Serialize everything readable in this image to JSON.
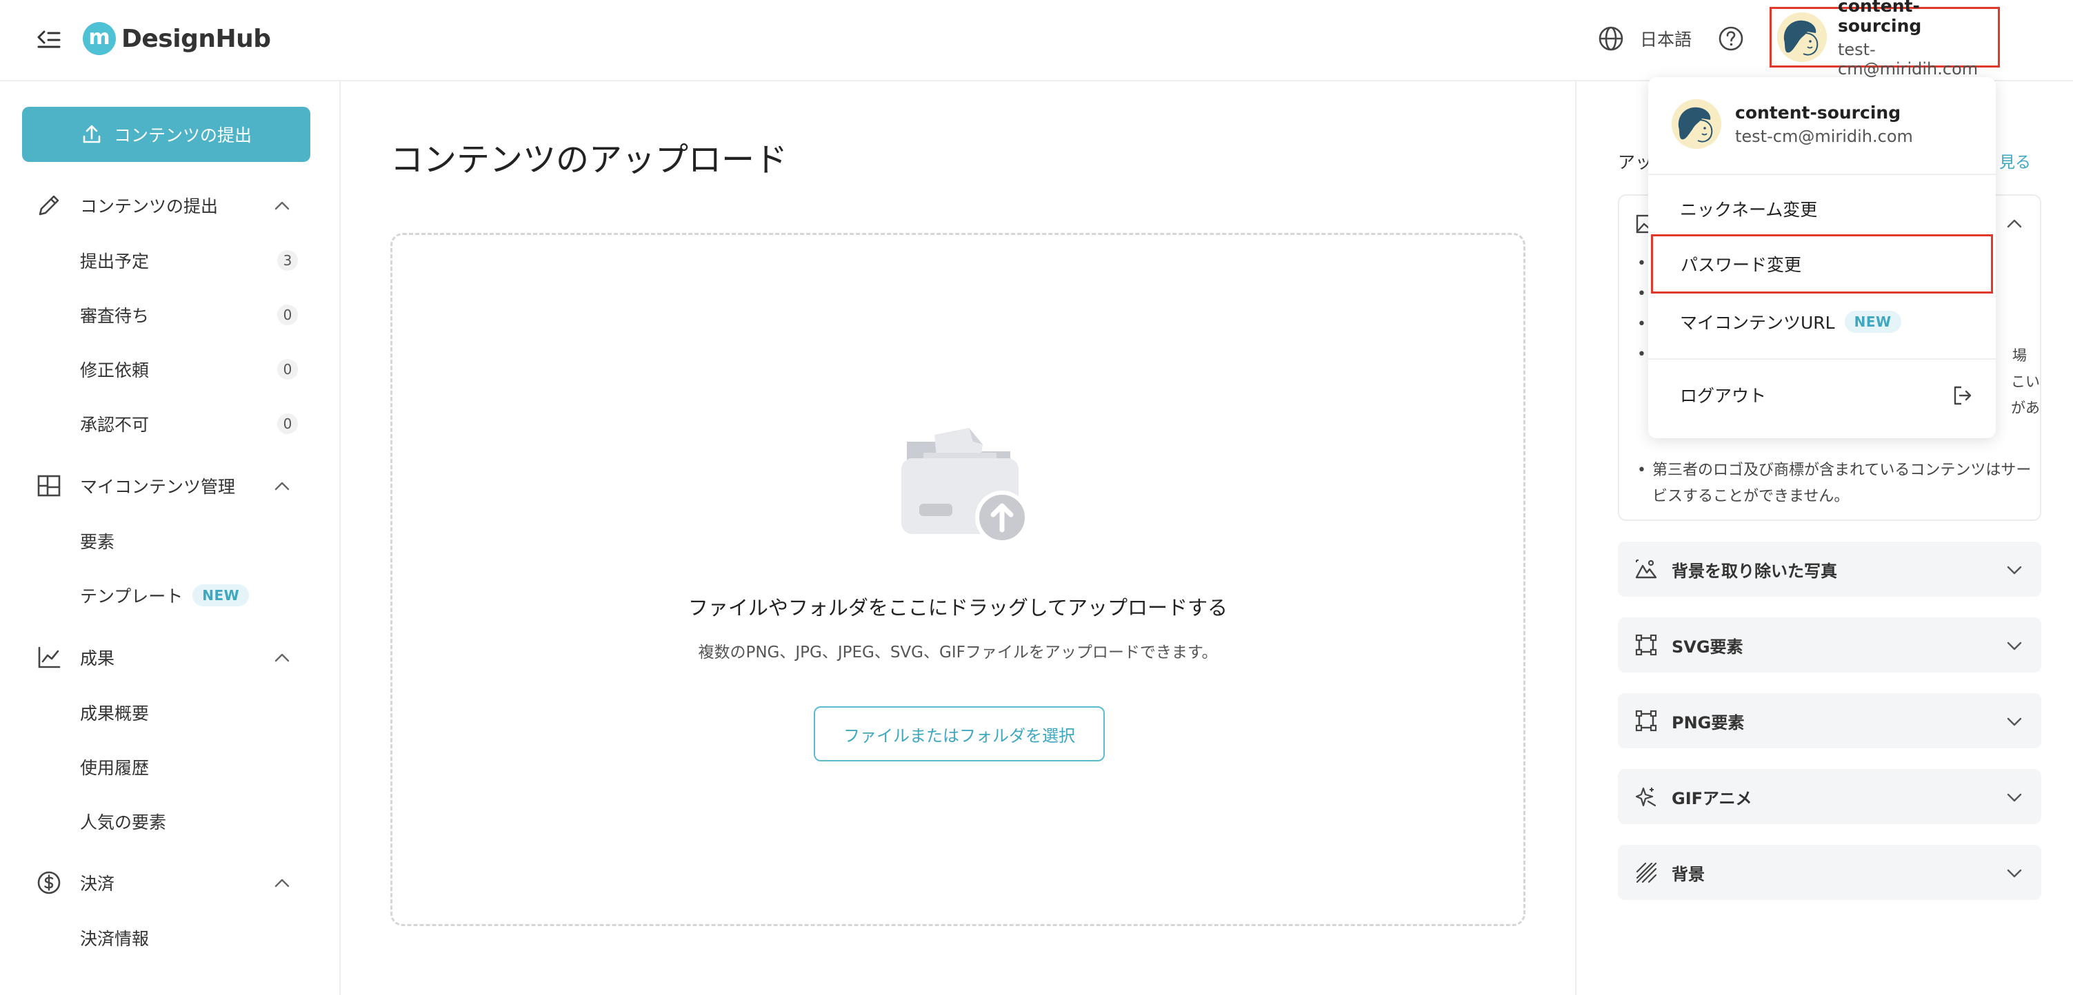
{
  "header": {
    "logo_letter": "m",
    "logo_text": "DesignHub",
    "language_label": "日本語",
    "user_name": "content-sourcing",
    "user_email": "test-cm@miridih.com"
  },
  "sidebar": {
    "submit_button_label": "コンテンツの提出",
    "sections": [
      {
        "label": "コンテンツの提出",
        "icon": "pencil-icon"
      },
      {
        "label": "マイコンテンツ管理",
        "icon": "layout-icon"
      },
      {
        "label": "成果",
        "icon": "chart-icon"
      },
      {
        "label": "決済",
        "icon": "dollar-icon"
      }
    ],
    "submission_items": [
      {
        "label": "提出予定",
        "count": "3"
      },
      {
        "label": "審査待ち",
        "count": "0"
      },
      {
        "label": "修正依頼",
        "count": "0"
      },
      {
        "label": "承認不可",
        "count": "0"
      }
    ],
    "my_content_items": [
      {
        "label": "要素"
      },
      {
        "label": "テンプレート",
        "badge": "NEW"
      }
    ],
    "results_items": [
      {
        "label": "成果概要"
      },
      {
        "label": "使用履歴"
      },
      {
        "label": "人気の要素"
      }
    ],
    "payment_items": [
      {
        "label": "決済情報"
      }
    ]
  },
  "main": {
    "title": "コンテンツのアップロード",
    "dropzone": {
      "title": "ファイルやフォルダをここにドラッグしてアップロードする",
      "subtitle": "複数のPNG、JPG、JPEG、SVG、GIFファイルをアップロードできます。",
      "button_label": "ファイルまたはフォルダを選択"
    }
  },
  "right_panel": {
    "guide_title_fragment": "アッ",
    "guide_more_link": "く見る",
    "guide_text_fragments": [
      "場",
      "こい",
      "があ"
    ],
    "guide_note": "第三者のロゴ及び商標が含まれているコンテンツはサービスすることができません。",
    "categories": [
      {
        "label": "背景を取り除いた写真",
        "icon": "mountain-icon"
      },
      {
        "label": "SVG要素",
        "icon": "vector-frame-icon"
      },
      {
        "label": "PNG要素",
        "icon": "vector-frame-icon"
      },
      {
        "label": "GIFアニメ",
        "icon": "sparkle-icon"
      },
      {
        "label": "背景",
        "icon": "hatch-icon"
      }
    ]
  },
  "dropdown": {
    "user_name": "content-sourcing",
    "user_email": "test-cm@miridih.com",
    "items": [
      {
        "label": "ニックネーム変更"
      },
      {
        "label": "パスワード変更"
      },
      {
        "label": "マイコンテンツURL",
        "badge": "NEW"
      },
      {
        "label": "ログアウト"
      }
    ]
  },
  "colors": {
    "accent": "#4fb3c8",
    "highlight_border": "#e0392b",
    "category_bg": "#f4f5f6"
  }
}
